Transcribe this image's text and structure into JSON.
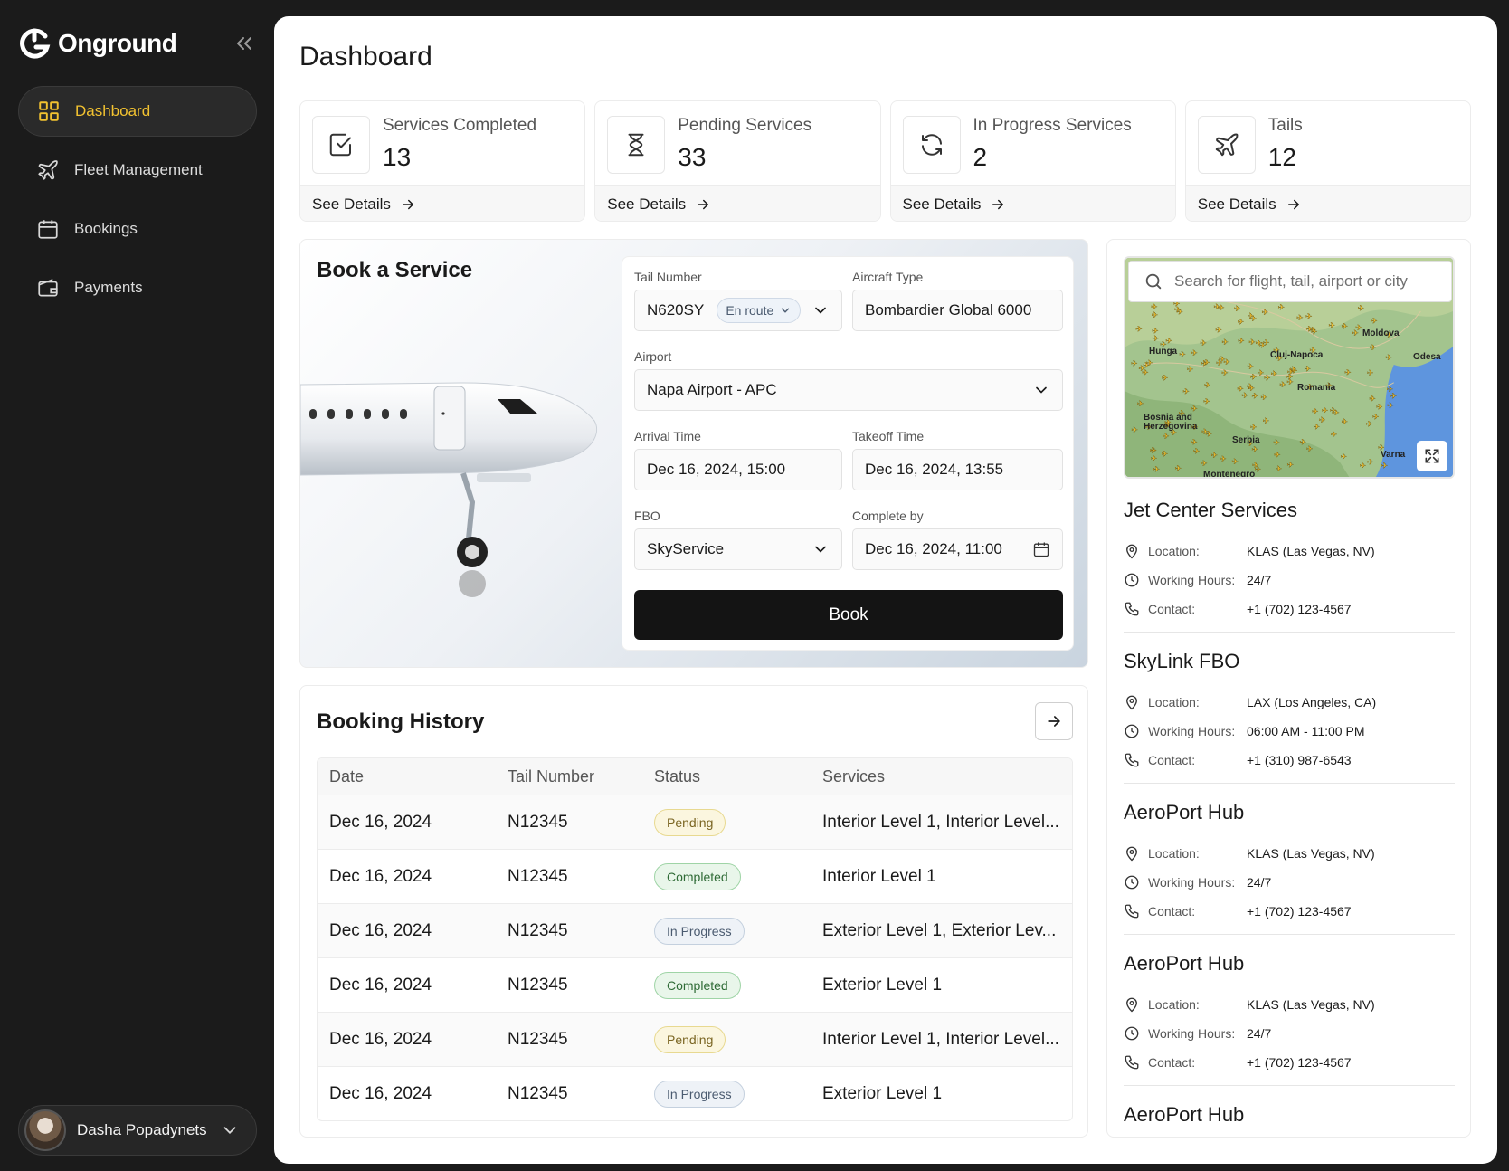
{
  "app": {
    "name": "Onground"
  },
  "sidebar": {
    "items": [
      {
        "label": "Dashboard",
        "icon": "grid-icon",
        "active": true
      },
      {
        "label": "Fleet Management",
        "icon": "plane-icon",
        "active": false
      },
      {
        "label": "Bookings",
        "icon": "calendar-icon",
        "active": false
      },
      {
        "label": "Payments",
        "icon": "wallet-icon",
        "active": false
      }
    ],
    "user": {
      "name": "Dasha Popadynets"
    }
  },
  "page": {
    "title": "Dashboard"
  },
  "stats": [
    {
      "label": "Services Completed",
      "value": "13",
      "icon": "check-square-icon",
      "link": "See Details"
    },
    {
      "label": "Pending Services",
      "value": "33",
      "icon": "hourglass-icon",
      "link": "See Details"
    },
    {
      "label": "In Progress Services",
      "value": "2",
      "icon": "refresh-icon",
      "link": "See Details"
    },
    {
      "label": "Tails",
      "value": "12",
      "icon": "plane-icon",
      "link": "See Details"
    }
  ],
  "book": {
    "title": "Book a Service",
    "tail_label": "Tail Number",
    "tail_value": "N620SY",
    "tail_status": "En route",
    "aircraft_label": "Aircraft Type",
    "aircraft_value": "Bombardier Global 6000",
    "airport_label": "Airport",
    "airport_value": "Napa Airport - APC",
    "arrival_label": "Arrival Time",
    "arrival_value": "Dec 16, 2024, 15:00",
    "takeoff_label": "Takeoff Time",
    "takeoff_value": "Dec 16, 2024, 13:55",
    "fbo_label": "FBO",
    "fbo_value": "SkyService",
    "complete_label": "Complete by",
    "complete_value": "Dec 16, 2024, 11:00",
    "button": "Book"
  },
  "history": {
    "title": "Booking History",
    "columns": [
      "Date",
      "Tail Number",
      "Status",
      "Services"
    ],
    "rows": [
      {
        "date": "Dec 16, 2024",
        "tail": "N12345",
        "status": "Pending",
        "services": "Interior Level 1, Interior Level..."
      },
      {
        "date": "Dec 16, 2024",
        "tail": "N12345",
        "status": "Completed",
        "services": "Interior Level 1"
      },
      {
        "date": "Dec 16, 2024",
        "tail": "N12345",
        "status": "In Progress",
        "services": "Exterior Level 1, Exterior Lev..."
      },
      {
        "date": "Dec 16, 2024",
        "tail": "N12345",
        "status": "Completed",
        "services": "Exterior Level 1"
      },
      {
        "date": "Dec 16, 2024",
        "tail": "N12345",
        "status": "Pending",
        "services": "Interior Level 1, Interior Level..."
      },
      {
        "date": "Dec 16, 2024",
        "tail": "N12345",
        "status": "In Progress",
        "services": "Exterior Level 1"
      }
    ]
  },
  "map": {
    "search_placeholder": "Search for flight, tail, airport or city",
    "labels": [
      "Moldova",
      "Hunga",
      "Romania",
      "Odesa",
      "Serbia",
      "Bosnia and Herzegovina",
      "Cluj-Napoca",
      "Montenegro",
      "Varna"
    ]
  },
  "fbo": {
    "location_key": "Location:",
    "hours_key": "Working Hours:",
    "contact_key": "Contact:",
    "list": [
      {
        "name": "Jet Center Services",
        "location": "KLAS (Las Vegas, NV)",
        "hours": "24/7",
        "contact": "+1 (702) 123-4567"
      },
      {
        "name": "SkyLink FBO",
        "location": "LAX (Los Angeles, CA)",
        "hours": "06:00 AM - 11:00 PM",
        "contact": "+1 (310) 987-6543"
      },
      {
        "name": "AeroPort Hub",
        "location": "KLAS (Las Vegas, NV)",
        "hours": "24/7",
        "contact": "+1 (702) 123-4567"
      },
      {
        "name": "AeroPort Hub",
        "location": "KLAS (Las Vegas, NV)",
        "hours": "24/7",
        "contact": "+1 (702) 123-4567"
      },
      {
        "name": "AeroPort Hub"
      }
    ]
  },
  "colors": {
    "accent": "#f2c230",
    "sidebar_bg": "#1b1b1b",
    "button_bg": "#141414"
  }
}
